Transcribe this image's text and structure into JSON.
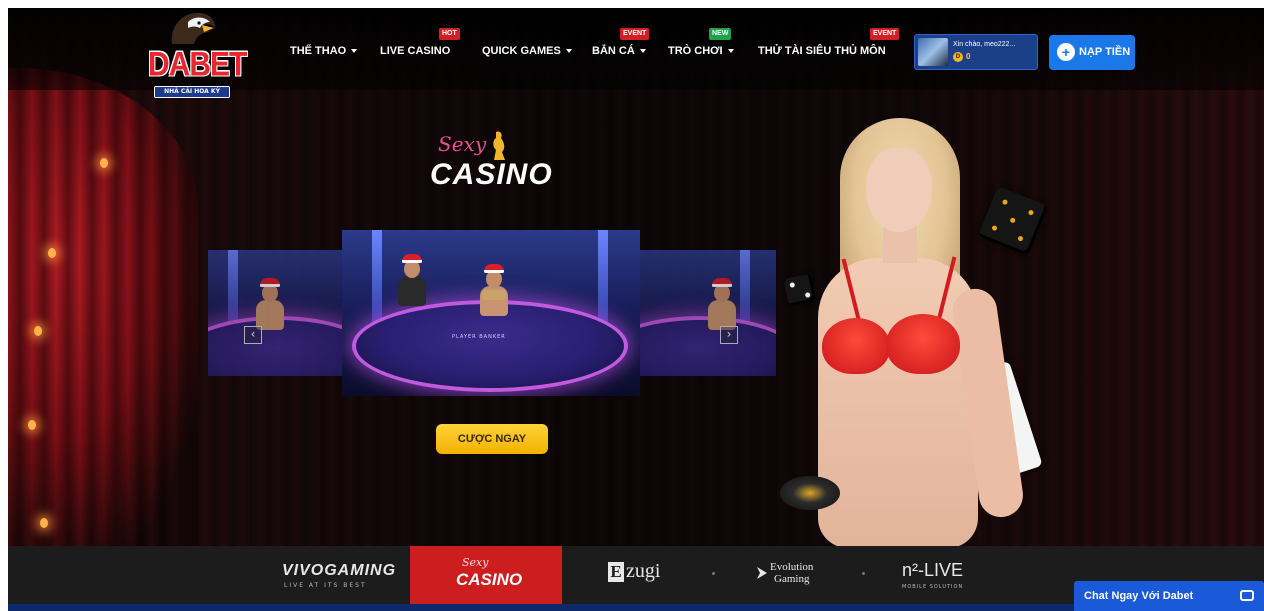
{
  "brand": {
    "name": "DABET",
    "slogan": "NHÀ CÁI HOA KỲ",
    "colors": {
      "red": "#e8262f",
      "blue": "#1a78e8",
      "gold": "#f6c740"
    }
  },
  "nav": {
    "items": [
      {
        "label": "THỂ THAO",
        "dropdown": true,
        "tag": ""
      },
      {
        "label": "LIVE CASINO",
        "dropdown": false,
        "tag": "HOT"
      },
      {
        "label": "QUICK GAMES",
        "dropdown": true,
        "tag": ""
      },
      {
        "label": "BẮN CÁ",
        "dropdown": true,
        "tag": "EVENT"
      },
      {
        "label": "TRÒ CHƠI",
        "dropdown": true,
        "tag": "NEW"
      },
      {
        "label": "THỬ TÀI SIÊU THỦ MÔN",
        "dropdown": false,
        "tag": "EVENT"
      }
    ]
  },
  "user": {
    "greeting": "Xin chào, meo222...",
    "coin_symbol": "D",
    "balance": "0"
  },
  "deposit": {
    "label": "NẠP TIỀN",
    "icon": "plus-circle-icon"
  },
  "hero": {
    "logo_script": "Sexy",
    "logo_word": "CASINO",
    "table_text": "PLAYER   BANKER",
    "prev_icon": "‹",
    "next_icon": "›",
    "cta_label": "CƯỢC NGAY"
  },
  "providers": {
    "items": [
      {
        "name": "VIVOGAMING",
        "sub": "LIVE AT ITS BEST"
      },
      {
        "name": "CASINO",
        "script": "Sexy",
        "active": true
      },
      {
        "name": "zugi",
        "mark": "E"
      },
      {
        "name": "Evolution",
        "sub": "Gaming"
      },
      {
        "name": "n²-LIVE",
        "sub": "MOBILE SOLUTION"
      }
    ]
  },
  "chat": {
    "label": "Chat Ngay Với Dabet",
    "icon": "chat-bubble-icon"
  }
}
